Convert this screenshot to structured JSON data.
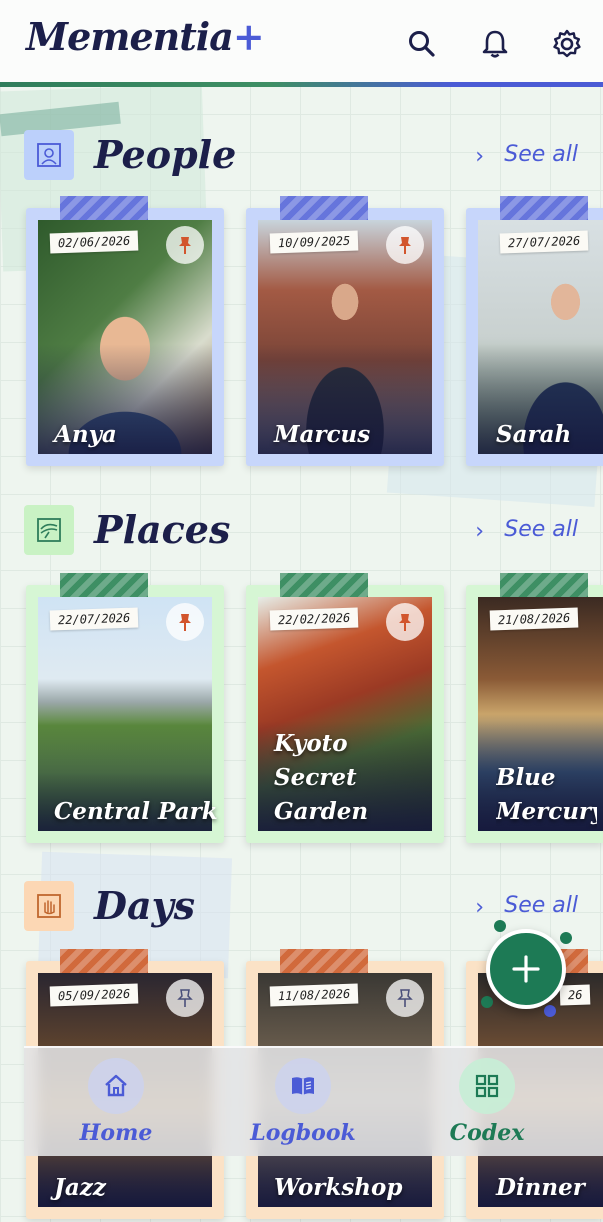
{
  "app": {
    "name": "Mementia",
    "plus": "+"
  },
  "header_icons": [
    "search-icon",
    "bell-icon",
    "gear-icon"
  ],
  "colors": {
    "navy": "#1c1f4a",
    "accent": "#4b5bd6",
    "green": "#1d7a55",
    "people_frame": "#c7d6fb",
    "places_frame": "#d6f6d4",
    "days_frame": "#fbe2c6"
  },
  "sections": [
    {
      "title": "People",
      "see_all": "See all",
      "cards": [
        {
          "date": "02/06/2026",
          "name": "Anya",
          "pinned": true
        },
        {
          "date": "10/09/2025",
          "name": "Marcus",
          "pinned": true
        },
        {
          "date": "27/07/2026",
          "name": "Sarah",
          "pinned": false
        }
      ]
    },
    {
      "title": "Places",
      "see_all": "See all",
      "cards": [
        {
          "date": "22/07/2026",
          "name": "Central Park",
          "pinned": true
        },
        {
          "date": "22/02/2026",
          "name": "Kyoto Secret\nGarden",
          "pinned": true
        },
        {
          "date": "21/08/2026",
          "name": "Blue\nMercury C",
          "pinned": false
        }
      ]
    },
    {
      "title": "Days",
      "see_all": "See all",
      "cards": [
        {
          "date": "05/09/2026",
          "name": "Jazz",
          "pinned": false
        },
        {
          "date": "11/08/2026",
          "name": "Workshop",
          "pinned": false
        },
        {
          "date": "26",
          "name": "Dinner",
          "pinned": false
        }
      ]
    }
  ],
  "fab": {
    "icon": "plus-icon"
  },
  "nav": [
    {
      "label": "Home",
      "icon": "home-icon",
      "active": false
    },
    {
      "label": "Logbook",
      "icon": "book-icon",
      "active": false
    },
    {
      "label": "Codex",
      "icon": "grid-icon",
      "active": true
    }
  ]
}
